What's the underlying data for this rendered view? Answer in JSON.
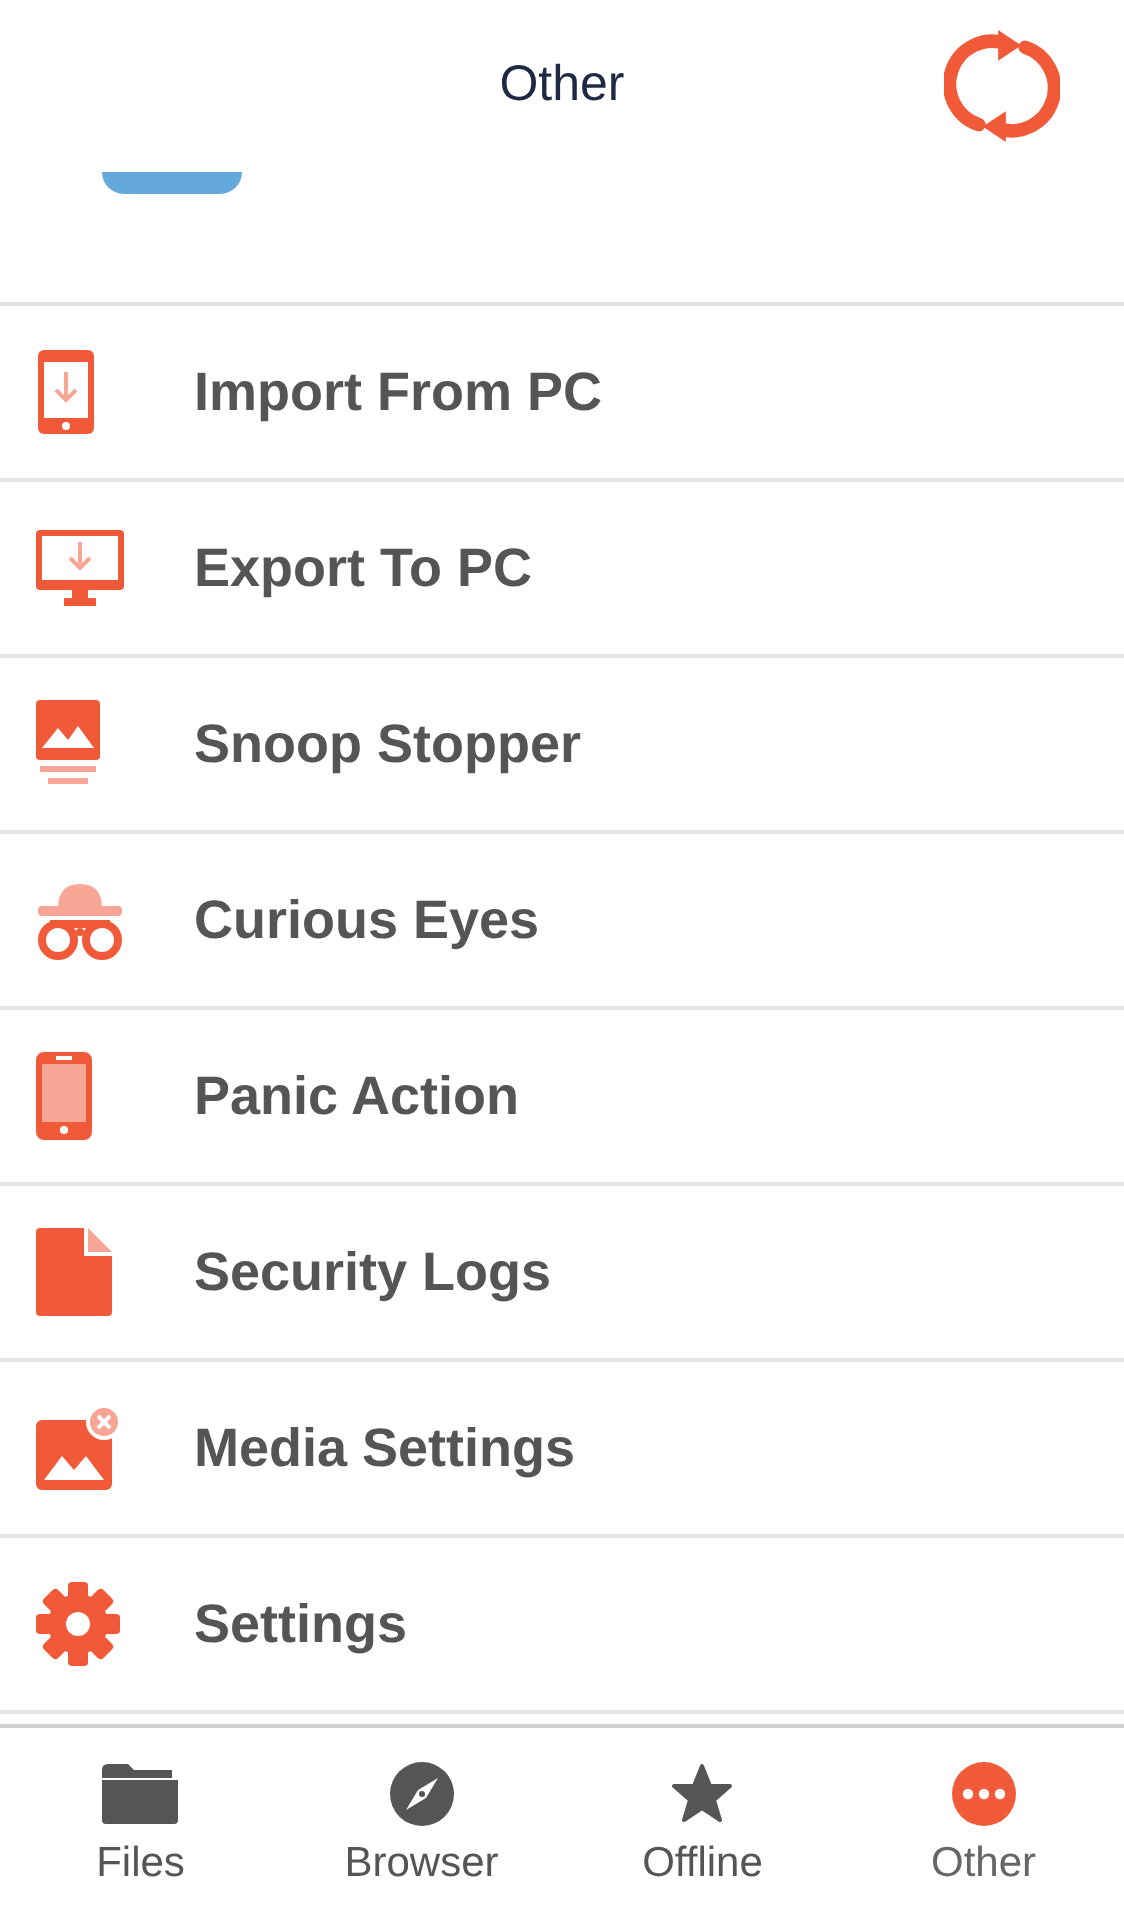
{
  "header": {
    "title": "Other"
  },
  "items": [
    {
      "label": "Import From PC",
      "kind": "import"
    },
    {
      "label": "Export To PC",
      "kind": "export"
    },
    {
      "label": "Snoop Stopper",
      "kind": "snoop"
    },
    {
      "label": "Curious Eyes",
      "kind": "eyes"
    },
    {
      "label": "Panic Action",
      "kind": "panic"
    },
    {
      "label": "Security Logs",
      "kind": "logs"
    },
    {
      "label": "Media Settings",
      "kind": "media"
    },
    {
      "label": "Settings",
      "kind": "settings"
    }
  ],
  "tabs": [
    {
      "label": "Files",
      "kind": "files",
      "selected": false
    },
    {
      "label": "Browser",
      "kind": "browser",
      "selected": false
    },
    {
      "label": "Offline",
      "kind": "offline",
      "selected": false
    },
    {
      "label": "Other",
      "kind": "other",
      "selected": true
    }
  ]
}
